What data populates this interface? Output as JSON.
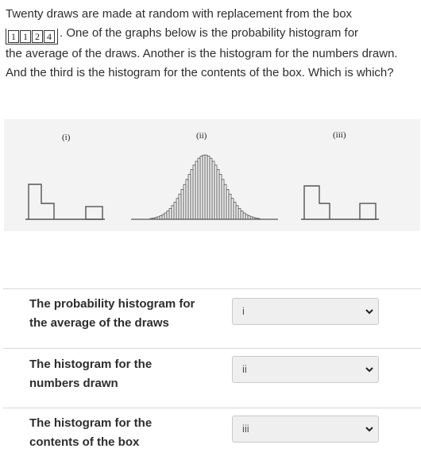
{
  "question": {
    "line1": "Twenty draws are made at random with replacement from the box",
    "box_numbers": [
      "1",
      "1",
      "2",
      "4"
    ],
    "line2": ". One of the graphs below is the probability histogram for",
    "line3": "the average of the draws. Another is the histogram for the numbers drawn.",
    "line4": "And the third is the histogram for the contents of the box. Which is which?"
  },
  "figure": {
    "labels": [
      "(i)",
      "(ii)",
      "(iii)"
    ]
  },
  "rows": [
    {
      "label_line1": "The probability histogram for",
      "label_line2": "the average of the draws",
      "selected": "i"
    },
    {
      "label_line1": "The histogram for the",
      "label_line2": "numbers drawn",
      "selected": "ii"
    },
    {
      "label_line1": "The histogram for the",
      "label_line2": "contents of the box",
      "selected": "iii"
    }
  ]
}
